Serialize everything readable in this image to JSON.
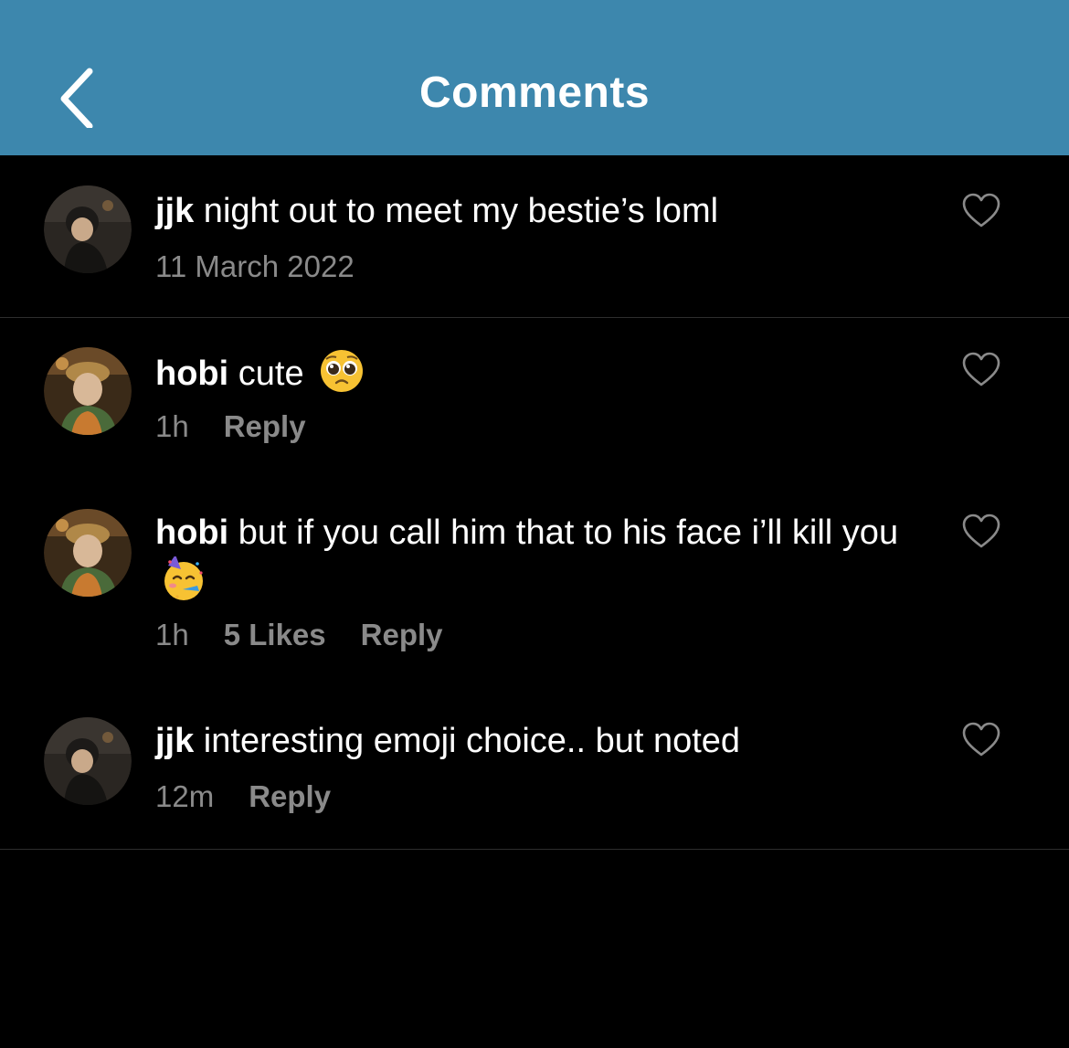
{
  "header": {
    "title": "Comments",
    "back_icon": "chevron-left-icon",
    "background_color": "#3d87ad"
  },
  "post": {
    "username": "jjk",
    "caption": " night out to meet my bestie’s loml",
    "date": "11 March 2022"
  },
  "comments": [
    {
      "username": "hobi",
      "text": " cute",
      "emoji": "pleading-face-emoji",
      "time": "1h",
      "likes": "",
      "reply_label": "Reply"
    },
    {
      "username": "hobi",
      "text": " but if you call him that to his face i’ll kill you",
      "emoji": "partying-face-emoji",
      "time": "1h",
      "likes": "5 Likes",
      "reply_label": "Reply"
    },
    {
      "username": "jjk",
      "text": " interesting emoji choice.. but noted",
      "emoji": "",
      "time": "12m",
      "likes": "",
      "reply_label": "Reply"
    }
  ],
  "colors": {
    "background": "#000000",
    "text": "#ffffff",
    "meta": "#8a8a8a"
  }
}
